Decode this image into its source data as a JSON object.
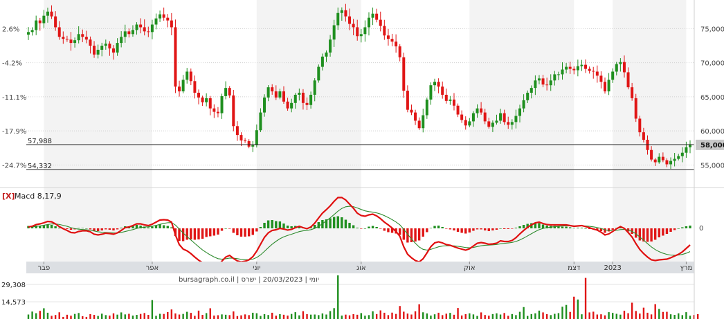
{
  "chart_data": [
    {
      "type": "candlestick",
      "title": "",
      "y_axis_right": {
        "ticks": [
          55000,
          60000,
          65000,
          70000,
          75000
        ],
        "labels": [
          "55,000",
          "60,000",
          "65,000",
          "70,000",
          "75,000"
        ],
        "ylim": [
          52000,
          79000
        ]
      },
      "y_axis_left": {
        "labels": [
          "2.6%",
          "-4.2%",
          "-11.1%",
          "-17.9%",
          "-24.7%"
        ],
        "at_values": [
          75000,
          70000,
          65000,
          60000,
          55000
        ]
      },
      "last_price": 58000,
      "last_price_label": "58,000",
      "horizontal_lines": [
        {
          "value": 57988,
          "label": "57,988"
        },
        {
          "value": 54332,
          "label": "54,332"
        }
      ],
      "close_series": [
        74500,
        74800,
        76200,
        75800,
        76900,
        77500,
        76800,
        75200,
        73800,
        73500,
        73400,
        72900,
        73300,
        74200,
        73800,
        73400,
        72500,
        71200,
        71900,
        72500,
        72800,
        72100,
        71500,
        72900,
        73800,
        74600,
        74200,
        74800,
        75600,
        75200,
        74600,
        74500,
        75600,
        76500,
        77100,
        76600,
        76200,
        75200,
        66500,
        65800,
        67500,
        68700,
        67300,
        65600,
        64900,
        64200,
        64800,
        63300,
        62800,
        62600,
        65100,
        66300,
        65200,
        60700,
        59400,
        58600,
        58500,
        57700,
        57900,
        60100,
        62700,
        64900,
        66400,
        65800,
        64900,
        65800,
        64300,
        63300,
        64100,
        65300,
        65600,
        64100,
        63800,
        65300,
        67400,
        69400,
        70900,
        71500,
        73400,
        75500,
        77300,
        77700,
        76800,
        75700,
        75200,
        73900,
        74200,
        75200,
        76600,
        77200,
        76300,
        75400,
        74000,
        73500,
        73100,
        72400,
        70800,
        65900,
        63100,
        62700,
        61500,
        60400,
        62300,
        64600,
        66700,
        67200,
        66500,
        65300,
        64400,
        64600,
        63700,
        62400,
        61600,
        60800,
        61400,
        62600,
        63300,
        62700,
        61400,
        60600,
        61200,
        61500,
        62600,
        61300,
        60900,
        61300,
        62200,
        63300,
        64500,
        65600,
        66300,
        67400,
        67700,
        66800,
        66700,
        67400,
        68300,
        68300,
        69000,
        69400,
        69100,
        68900,
        69500,
        69700,
        69100,
        68800,
        68700,
        68100,
        67200,
        65800,
        67500,
        68700,
        69800,
        70100,
        68600,
        66400,
        64800,
        61800,
        59800,
        58700,
        57200,
        55800,
        55400,
        56200,
        55700,
        55100,
        55600,
        55900,
        56300,
        56800,
        57600,
        58000
      ],
      "x_axis": {
        "labels": [
          "פבר",
          "אפר",
          "יוני",
          "אוג",
          "אוק",
          "דצמ",
          "2023",
          "מרץ"
        ],
        "at_index": [
          4,
          32,
          59,
          86,
          114,
          141,
          151,
          170
        ]
      }
    },
    {
      "type": "macd",
      "title": "Macd 8,17,9",
      "close_label": "[X]",
      "zero_label": "0",
      "histogram": [
        0.7,
        0.8,
        0.8,
        0.7,
        0.9,
        1.1,
        1.0,
        0.6,
        0.2,
        0.0,
        -0.2,
        -0.4,
        -0.3,
        0.1,
        0.1,
        0.0,
        -0.3,
        -0.8,
        -0.8,
        -0.6,
        -0.3,
        -0.4,
        -0.6,
        -0.3,
        0.2,
        0.6,
        0.6,
        0.8,
        1.0,
        0.8,
        0.5,
        0.3,
        0.5,
        0.8,
        1.1,
        0.9,
        0.7,
        0.3,
        -2.2,
        -3.6,
        -3.7,
        -3.3,
        -3.2,
        -3.3,
        -3.2,
        -3.0,
        -2.5,
        -2.3,
        -2.1,
        -1.8,
        -0.7,
        0.0,
        -0.1,
        -1.3,
        -2.0,
        -2.4,
        -2.4,
        -2.3,
        -1.9,
        -0.9,
        0.4,
        1.6,
        2.3,
        2.4,
        2.1,
        2.0,
        1.4,
        0.8,
        0.6,
        0.7,
        0.7,
        0.2,
        -0.1,
        0.3,
        1.0,
        1.8,
        2.4,
        2.6,
        2.9,
        3.3,
        3.5,
        3.2,
        2.5,
        1.6,
        0.9,
        0.2,
        -0.1,
        0.0,
        0.5,
        0.7,
        0.4,
        -0.1,
        -0.7,
        -1.1,
        -1.3,
        -1.5,
        -1.9,
        -3.3,
        -4.1,
        -4.0,
        -3.8,
        -3.5,
        -2.4,
        -1.1,
        0.1,
        0.7,
        0.8,
        0.4,
        -0.1,
        -0.3,
        -0.6,
        -1.0,
        -1.3,
        -1.5,
        -1.2,
        -0.7,
        -0.3,
        -0.3,
        -0.6,
        -0.8,
        -0.6,
        -0.4,
        0.0,
        -0.2,
        -0.2,
        -0.1,
        0.2,
        0.6,
        1.0,
        1.3,
        1.5,
        1.6,
        1.5,
        1.1,
        0.8,
        0.7,
        0.7,
        0.5,
        0.5,
        0.5,
        0.3,
        0.1,
        0.2,
        0.2,
        0.0,
        -0.2,
        -0.3,
        -0.5,
        -0.8,
        -1.3,
        -0.9,
        -0.4,
        0.1,
        0.4,
        -0.1,
        -0.9,
        -1.6,
        -2.7,
        -3.5,
        -3.8,
        -3.9,
        -3.8,
        -3.3,
        -2.6,
        -2.1,
        -1.6,
        -1.0,
        -0.5,
        0.0,
        0.3,
        0.6,
        0.8
      ],
      "macd": [
        0.4,
        0.6,
        1.1,
        1.3,
        1.6,
        2.0,
        1.9,
        1.3,
        0.5,
        -0.1,
        -0.6,
        -1.2,
        -1.3,
        -0.9,
        -0.7,
        -0.7,
        -1.0,
        -1.7,
        -1.9,
        -1.7,
        -1.4,
        -1.5,
        -1.7,
        -1.3,
        -0.6,
        0.2,
        0.4,
        0.8,
        1.3,
        1.3,
        1.0,
        0.8,
        1.2,
        1.8,
        2.4,
        2.5,
        2.4,
        1.8,
        -1.9,
        -4.7,
        -6.0,
        -6.5,
        -7.3,
        -8.3,
        -9.2,
        -9.9,
        -10.0,
        -10.4,
        -10.7,
        -10.7,
        -9.5,
        -8.3,
        -7.8,
        -8.7,
        -9.4,
        -9.7,
        -9.5,
        -9.1,
        -8.2,
        -6.6,
        -4.6,
        -2.6,
        -1.3,
        -0.6,
        -0.4,
        0.0,
        -0.2,
        -0.5,
        -0.3,
        0.2,
        0.6,
        0.2,
        -0.1,
        0.4,
        1.5,
        3.0,
        4.4,
        5.4,
        6.5,
        7.8,
        8.9,
        8.9,
        8.2,
        7.0,
        5.8,
        4.4,
        3.7,
        3.5,
        3.9,
        4.1,
        3.6,
        2.8,
        1.8,
        1.0,
        0.1,
        -0.9,
        -2.3,
        -5.3,
        -7.5,
        -8.5,
        -9.3,
        -9.7,
        -8.8,
        -7.1,
        -5.3,
        -4.2,
        -3.9,
        -4.2,
        -4.7,
        -4.9,
        -5.3,
        -5.7,
        -6.0,
        -6.3,
        -5.9,
        -5.1,
        -4.3,
        -4.1,
        -4.3,
        -4.6,
        -4.5,
        -4.3,
        -3.6,
        -3.8,
        -3.8,
        -3.5,
        -2.7,
        -1.6,
        -0.6,
        0.3,
        1.0,
        1.6,
        1.8,
        1.4,
        1.1,
        1.0,
        1.0,
        1.0,
        1.0,
        1.0,
        0.8,
        0.6,
        0.7,
        0.8,
        0.5,
        0.2,
        -0.2,
        -0.5,
        -1.1,
        -1.9,
        -1.6,
        -0.9,
        -0.1,
        0.5,
        0.0,
        -1.2,
        -2.5,
        -4.4,
        -6.1,
        -7.3,
        -8.3,
        -9.1,
        -9.3,
        -9.1,
        -9.0,
        -8.9,
        -8.5,
        -8.0,
        -7.5,
        -6.8,
        -5.8,
        -4.8
      ]
    },
    {
      "type": "bar",
      "title": "",
      "header_text": "יומי | 20/03/2023 | ישרס | bursagraph.co.il",
      "y_labels": [
        "29,308",
        "14,573"
      ],
      "y_ticks": [
        29308,
        14573
      ],
      "values": [
        3800,
        6300,
        4900,
        6900,
        9100,
        5300,
        2700,
        3400,
        5700,
        1800,
        3600,
        2800,
        4300,
        5100,
        2400,
        1800,
        4100,
        3500,
        2600,
        4500,
        3300,
        2900,
        4800,
        3700,
        5600,
        3900,
        4400,
        2900,
        3500,
        4300,
        5100,
        3500,
        16000,
        2700,
        4400,
        4300,
        5900,
        8100,
        4700,
        3800,
        4300,
        6100,
        5200,
        2700,
        7100,
        3500,
        5000,
        9100,
        2900,
        3200,
        3900,
        3600,
        3300,
        6400,
        2500,
        3100,
        3900,
        3300,
        5300,
        4900,
        2600,
        4100,
        3400,
        5300,
        2800,
        4100,
        3600,
        2900,
        4300,
        5800,
        3100,
        6600,
        4100,
        3700,
        3800,
        3300,
        4700,
        3800,
        6700,
        9200,
        37000,
        2900,
        3700,
        3100,
        4100,
        3600,
        5000,
        2800,
        3300,
        6500,
        4200,
        7300,
        5300,
        3300,
        5400,
        4300,
        11000,
        6200,
        4600,
        3800,
        6500,
        12500,
        5700,
        4700,
        2900,
        4000,
        5300,
        3300,
        4500,
        5200,
        3600,
        9300,
        3000,
        4100,
        4800,
        3900,
        2600,
        5600,
        3400,
        2800,
        4200,
        4800,
        3800,
        5100,
        2700,
        4200,
        3300,
        6100,
        10100,
        2600,
        4200,
        4800,
        7100,
        5600,
        4100,
        3300,
        4400,
        5000,
        10400,
        11900,
        6000,
        18900,
        16500,
        4000,
        34800,
        5600,
        6200,
        3800,
        4000,
        3100,
        5800,
        5200,
        4400,
        3700,
        7000,
        4900,
        13800,
        6800,
        4600,
        9600,
        5300,
        3900,
        12600,
        8500,
        6000,
        6100,
        4000,
        3500,
        4800,
        3300,
        5800,
        2800,
        3400,
        4100
      ]
    }
  ]
}
